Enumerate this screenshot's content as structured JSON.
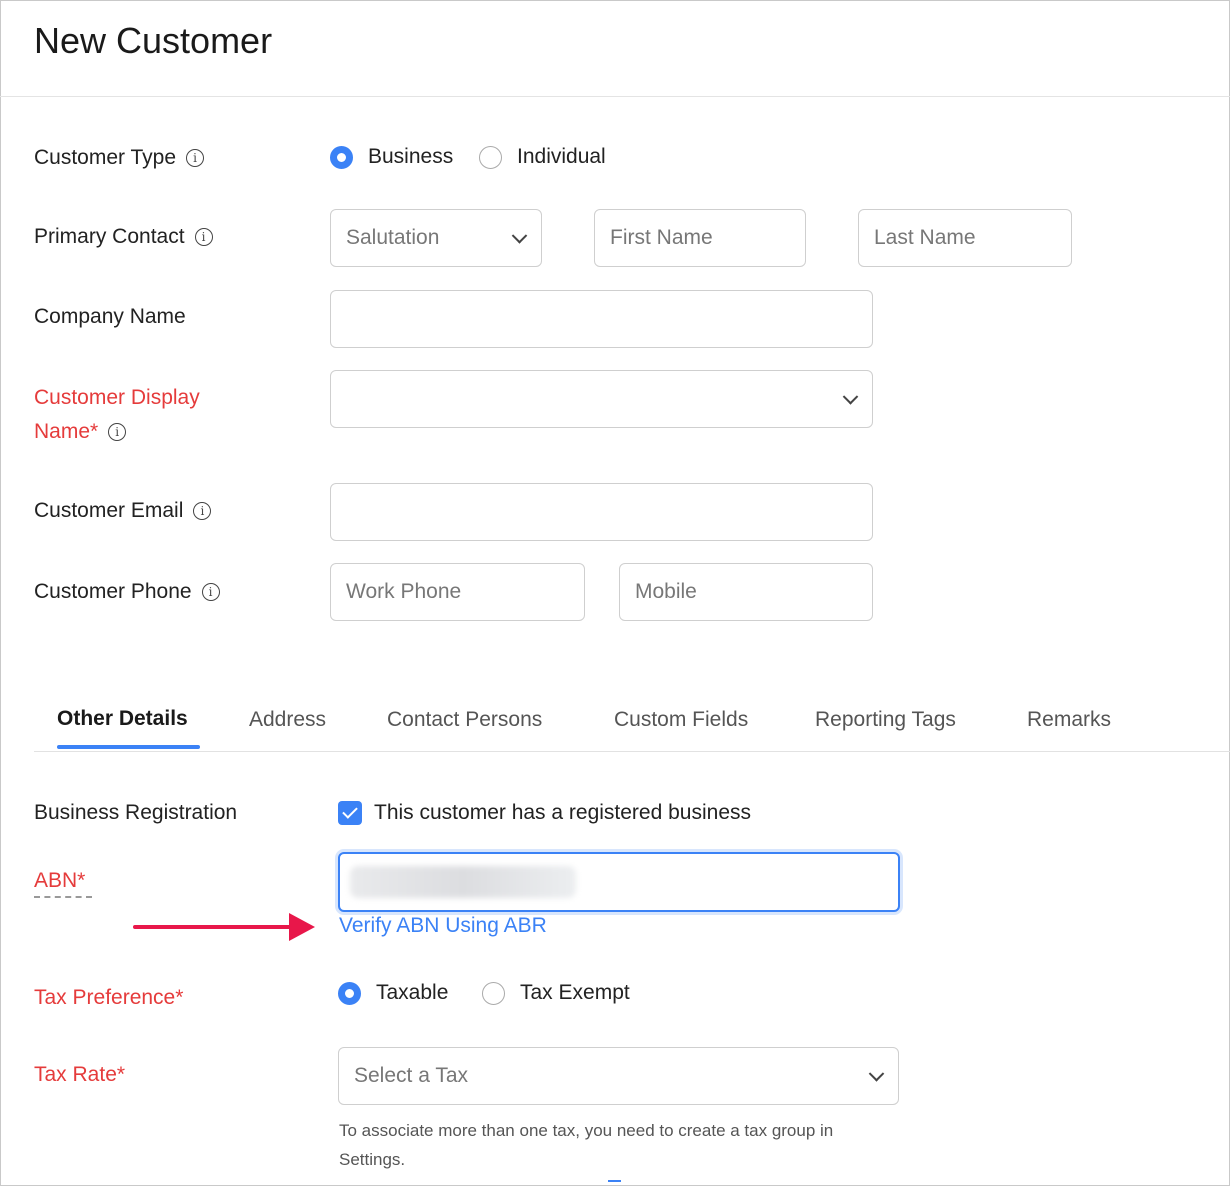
{
  "page": {
    "title": "New Customer"
  },
  "form": {
    "customer_type": {
      "label": "Customer Type",
      "options": [
        "Business",
        "Individual"
      ],
      "selected": "Business"
    },
    "primary_contact": {
      "label": "Primary Contact",
      "salutation": "Salutation",
      "first_name": "First Name",
      "last_name": "Last Name"
    },
    "company_name": {
      "label": "Company Name",
      "value": ""
    },
    "display_name": {
      "label_line1": "Customer Display",
      "label_line2": "Name*",
      "value": ""
    },
    "email": {
      "label": "Customer Email",
      "value": ""
    },
    "phone": {
      "label": "Customer Phone",
      "work": "Work Phone",
      "mobile": "Mobile"
    }
  },
  "tabs": [
    {
      "label": "Other Details",
      "active": true
    },
    {
      "label": "Address"
    },
    {
      "label": "Contact Persons"
    },
    {
      "label": "Custom Fields"
    },
    {
      "label": "Reporting Tags"
    },
    {
      "label": "Remarks"
    }
  ],
  "other_details": {
    "business_registration": {
      "label": "Business Registration",
      "checkbox_label": "This customer has a registered business",
      "checked": true
    },
    "abn": {
      "label": "ABN*",
      "verify_link": "Verify ABN Using ABR"
    },
    "tax_preference": {
      "label": "Tax Preference*",
      "options": [
        "Taxable",
        "Tax Exempt"
      ],
      "selected": "Taxable"
    },
    "tax_rate": {
      "label": "Tax Rate*",
      "placeholder": "Select a Tax",
      "help_line1": "To associate more than one tax, you need to create a tax group in",
      "help_line2": "Settings."
    }
  },
  "colors": {
    "accent": "#3b82f6",
    "required": "#e53b3b",
    "arrow": "#e8174a"
  },
  "icons": [
    "info-icon",
    "chevron-down-icon",
    "check-icon",
    "arrow-right-icon"
  ]
}
